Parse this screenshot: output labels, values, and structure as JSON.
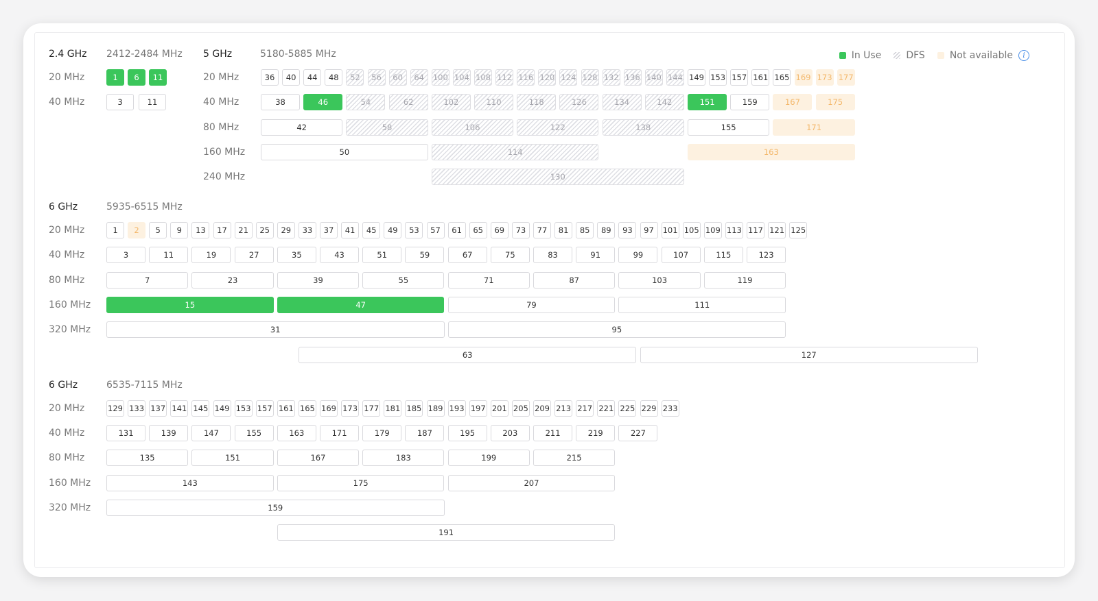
{
  "legend": {
    "in_use": "In Use",
    "dfs": "DFS",
    "not_available": "Not available",
    "colors": {
      "in_use": "#3bc65b",
      "dfs": "#dedfe4",
      "not_available": "#fdf1e0"
    }
  },
  "bands": [
    {
      "id": "b24",
      "title": "2.4 GHz",
      "range": "2412-2484 MHz",
      "rows": [
        {
          "label": "20 MHz",
          "channels": [
            [
              "1",
              "inuse"
            ],
            [
              "6",
              "inuse"
            ],
            [
              "11",
              "inuse"
            ]
          ]
        },
        {
          "label": "40 MHz",
          "channels": [
            [
              "3",
              ""
            ],
            [
              "11",
              ""
            ]
          ]
        }
      ]
    },
    {
      "id": "b5",
      "title": "5 GHz",
      "range": "5180-5885 MHz",
      "rows": [
        {
          "label": "20 MHz",
          "channels": [
            [
              "36",
              ""
            ],
            [
              "40",
              ""
            ],
            [
              "44",
              ""
            ],
            [
              "48",
              ""
            ],
            [
              "52",
              "dfs"
            ],
            [
              "56",
              "dfs"
            ],
            [
              "60",
              "dfs"
            ],
            [
              "64",
              "dfs"
            ],
            [
              "100",
              "dfs"
            ],
            [
              "104",
              "dfs"
            ],
            [
              "108",
              "dfs"
            ],
            [
              "112",
              "dfs"
            ],
            [
              "116",
              "dfs"
            ],
            [
              "120",
              "dfs"
            ],
            [
              "124",
              "dfs"
            ],
            [
              "128",
              "dfs"
            ],
            [
              "132",
              "dfs"
            ],
            [
              "136",
              "dfs"
            ],
            [
              "140",
              "dfs"
            ],
            [
              "144",
              "dfs"
            ],
            [
              "149",
              ""
            ],
            [
              "153",
              ""
            ],
            [
              "157",
              ""
            ],
            [
              "161",
              ""
            ],
            [
              "165",
              ""
            ],
            [
              "169",
              "na"
            ],
            [
              "173",
              "na"
            ],
            [
              "177",
              "na"
            ]
          ]
        },
        {
          "label": "40 MHz",
          "channels": [
            [
              "38",
              ""
            ],
            [
              "46",
              "inuse"
            ],
            [
              "54",
              "dfs"
            ],
            [
              "62",
              "dfs"
            ],
            [
              "102",
              "dfs"
            ],
            [
              "110",
              "dfs"
            ],
            [
              "118",
              "dfs"
            ],
            [
              "126",
              "dfs"
            ],
            [
              "134",
              "dfs"
            ],
            [
              "142",
              "dfs"
            ],
            [
              "151",
              "inuse"
            ],
            [
              "159",
              ""
            ],
            [
              "167",
              "na"
            ],
            [
              "175",
              "na"
            ]
          ]
        },
        {
          "label": "80 MHz",
          "channels": [
            [
              "42",
              ""
            ],
            [
              "58",
              "dfs"
            ],
            [
              "106",
              "dfs"
            ],
            [
              "122",
              "dfs"
            ],
            [
              "138",
              "dfs"
            ],
            [
              "155",
              ""
            ],
            [
              "171",
              "na"
            ]
          ]
        },
        {
          "label": "160 MHz",
          "channels": [
            [
              "50",
              ""
            ],
            [
              "114",
              "dfs"
            ],
            [
              "163",
              "na"
            ]
          ]
        },
        {
          "label": "240 MHz",
          "channels": [
            [
              "130",
              "dfs"
            ]
          ]
        }
      ]
    },
    {
      "id": "b6a",
      "title": "6 GHz",
      "range": "5935-6515 MHz",
      "rows": [
        {
          "label": "20 MHz",
          "channels": [
            [
              "1",
              ""
            ],
            [
              "2",
              "na"
            ],
            [
              "5",
              ""
            ],
            [
              "9",
              ""
            ],
            [
              "13",
              ""
            ],
            [
              "17",
              ""
            ],
            [
              "21",
              ""
            ],
            [
              "25",
              ""
            ],
            [
              "29",
              ""
            ],
            [
              "33",
              ""
            ],
            [
              "37",
              ""
            ],
            [
              "41",
              ""
            ],
            [
              "45",
              ""
            ],
            [
              "49",
              ""
            ],
            [
              "53",
              ""
            ],
            [
              "57",
              ""
            ],
            [
              "61",
              ""
            ],
            [
              "65",
              ""
            ],
            [
              "69",
              ""
            ],
            [
              "73",
              ""
            ],
            [
              "77",
              ""
            ],
            [
              "81",
              ""
            ],
            [
              "85",
              ""
            ],
            [
              "89",
              ""
            ],
            [
              "93",
              ""
            ],
            [
              "97",
              ""
            ],
            [
              "101",
              ""
            ],
            [
              "105",
              ""
            ],
            [
              "109",
              ""
            ],
            [
              "113",
              ""
            ],
            [
              "117",
              ""
            ],
            [
              "121",
              ""
            ],
            [
              "125",
              ""
            ]
          ]
        },
        {
          "label": "40 MHz",
          "channels": [
            [
              "3",
              ""
            ],
            [
              "11",
              ""
            ],
            [
              "19",
              ""
            ],
            [
              "27",
              ""
            ],
            [
              "35",
              ""
            ],
            [
              "43",
              ""
            ],
            [
              "51",
              ""
            ],
            [
              "59",
              ""
            ],
            [
              "67",
              ""
            ],
            [
              "75",
              ""
            ],
            [
              "83",
              ""
            ],
            [
              "91",
              ""
            ],
            [
              "99",
              ""
            ],
            [
              "107",
              ""
            ],
            [
              "115",
              ""
            ],
            [
              "123",
              ""
            ]
          ]
        },
        {
          "label": "80 MHz",
          "channels": [
            [
              "7",
              ""
            ],
            [
              "23",
              ""
            ],
            [
              "39",
              ""
            ],
            [
              "55",
              ""
            ],
            [
              "71",
              ""
            ],
            [
              "87",
              ""
            ],
            [
              "103",
              ""
            ],
            [
              "119",
              ""
            ]
          ]
        },
        {
          "label": "160 MHz",
          "channels": [
            [
              "15",
              "inuse"
            ],
            [
              "47",
              "inuse"
            ],
            [
              "79",
              ""
            ],
            [
              "111",
              ""
            ]
          ]
        },
        {
          "label": "320 MHz",
          "channels": [
            [
              "31",
              ""
            ],
            [
              "95",
              ""
            ]
          ]
        },
        {
          "label": "",
          "channels": [
            [
              "63",
              ""
            ],
            [
              "127",
              ""
            ]
          ]
        }
      ]
    },
    {
      "id": "b6b",
      "title": "6 GHz",
      "range": "6535-7115 MHz",
      "rows": [
        {
          "label": "20 MHz",
          "channels": [
            [
              "129",
              ""
            ],
            [
              "133",
              ""
            ],
            [
              "137",
              ""
            ],
            [
              "141",
              ""
            ],
            [
              "145",
              ""
            ],
            [
              "149",
              ""
            ],
            [
              "153",
              ""
            ],
            [
              "157",
              ""
            ],
            [
              "161",
              ""
            ],
            [
              "165",
              ""
            ],
            [
              "169",
              ""
            ],
            [
              "173",
              ""
            ],
            [
              "177",
              ""
            ],
            [
              "181",
              ""
            ],
            [
              "185",
              ""
            ],
            [
              "189",
              ""
            ],
            [
              "193",
              ""
            ],
            [
              "197",
              ""
            ],
            [
              "201",
              ""
            ],
            [
              "205",
              ""
            ],
            [
              "209",
              ""
            ],
            [
              "213",
              ""
            ],
            [
              "217",
              ""
            ],
            [
              "221",
              ""
            ],
            [
              "225",
              ""
            ],
            [
              "229",
              ""
            ],
            [
              "233",
              ""
            ]
          ]
        },
        {
          "label": "40 MHz",
          "channels": [
            [
              "131",
              ""
            ],
            [
              "139",
              ""
            ],
            [
              "147",
              ""
            ],
            [
              "155",
              ""
            ],
            [
              "163",
              ""
            ],
            [
              "171",
              ""
            ],
            [
              "179",
              ""
            ],
            [
              "187",
              ""
            ],
            [
              "195",
              ""
            ],
            [
              "203",
              ""
            ],
            [
              "211",
              ""
            ],
            [
              "219",
              ""
            ],
            [
              "227",
              ""
            ]
          ]
        },
        {
          "label": "80 MHz",
          "channels": [
            [
              "135",
              ""
            ],
            [
              "151",
              ""
            ],
            [
              "167",
              ""
            ],
            [
              "183",
              ""
            ],
            [
              "199",
              ""
            ],
            [
              "215",
              ""
            ]
          ]
        },
        {
          "label": "160 MHz",
          "channels": [
            [
              "143",
              ""
            ],
            [
              "175",
              ""
            ],
            [
              "207",
              ""
            ]
          ]
        },
        {
          "label": "320 MHz",
          "channels": [
            [
              "159",
              ""
            ]
          ]
        },
        {
          "label": "",
          "channels": [
            [
              "191",
              ""
            ]
          ]
        }
      ]
    }
  ]
}
